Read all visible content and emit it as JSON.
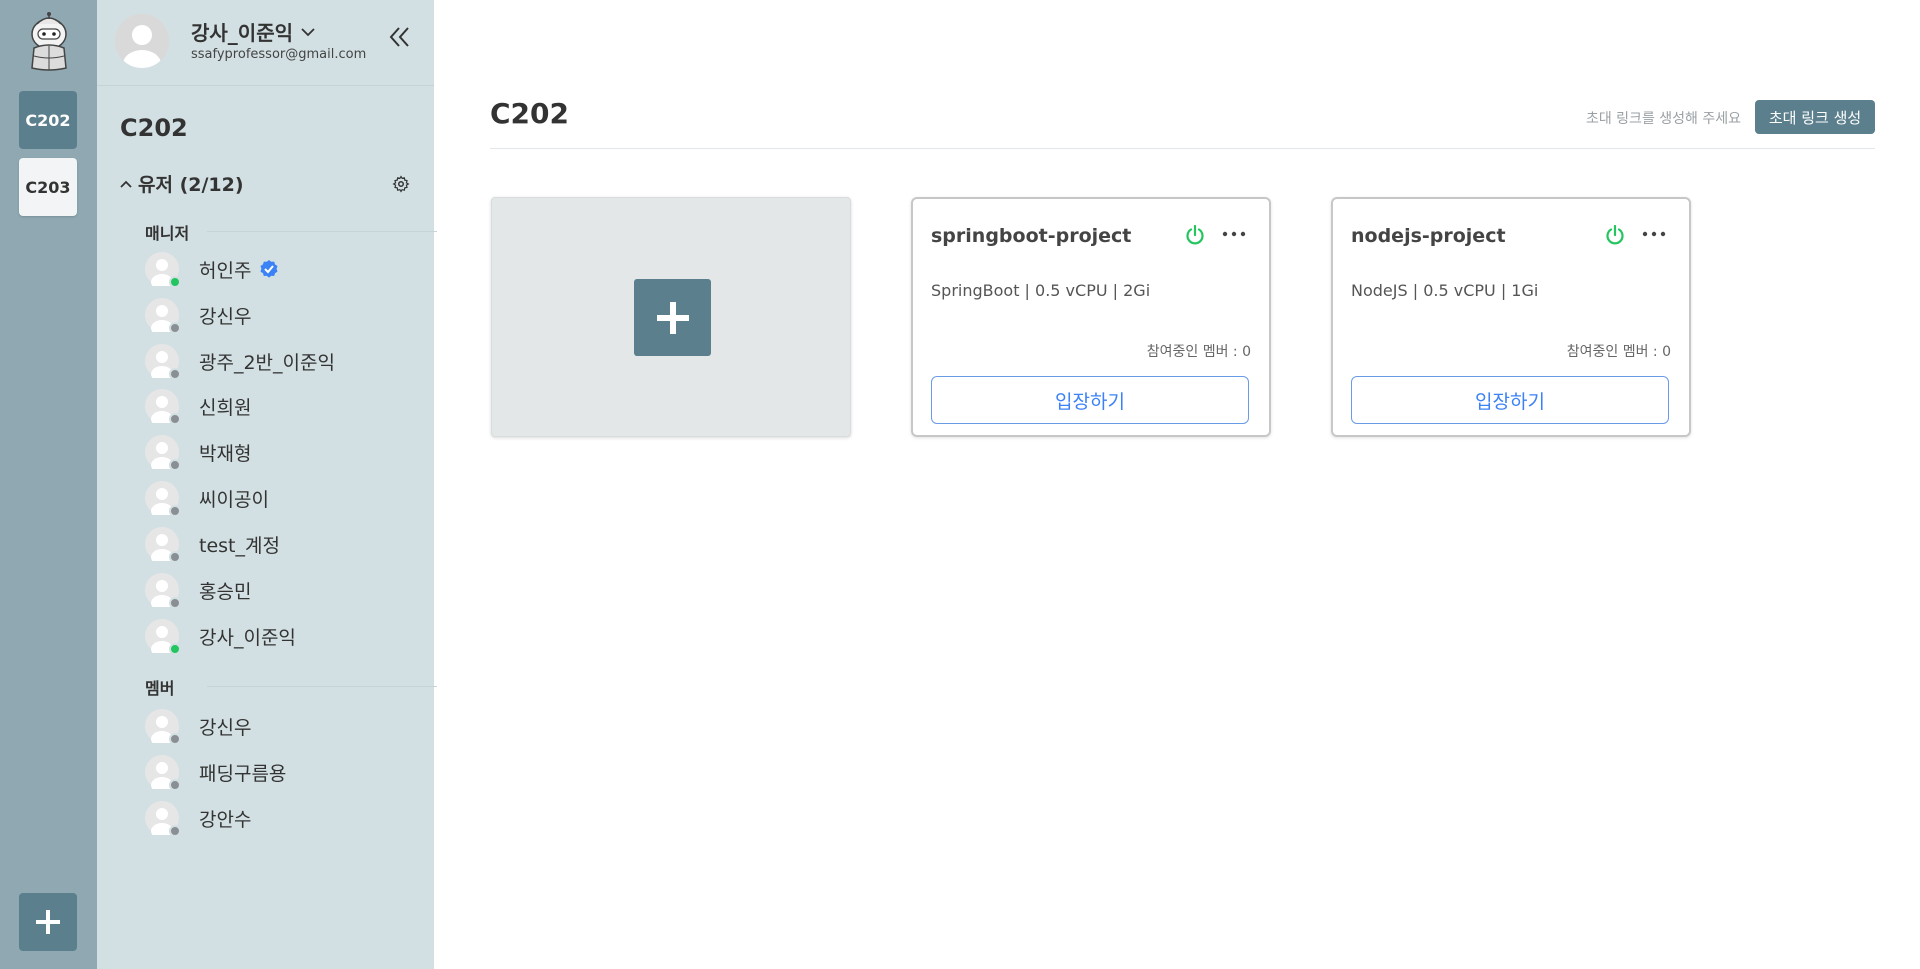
{
  "rail": {
    "workspaces": [
      "C202",
      "C203"
    ],
    "active": "C202"
  },
  "profile": {
    "name": "강사_이준익",
    "email": "ssafyprofessor@gmail.com"
  },
  "sidebar": {
    "team_title": "C202",
    "users_label": "유저 (2/12)",
    "managers_label": "매니저",
    "members_label": "멤버",
    "managers": [
      {
        "name": "허인주",
        "status": "online",
        "verified": true
      },
      {
        "name": "강신우",
        "status": "offline"
      },
      {
        "name": "광주_2반_이준익",
        "status": "offline"
      },
      {
        "name": "신희원",
        "status": "offline"
      },
      {
        "name": "박재형",
        "status": "offline"
      },
      {
        "name": "씨이공이",
        "status": "offline"
      },
      {
        "name": "test_계정",
        "status": "offline"
      },
      {
        "name": "홍승민",
        "status": "offline"
      },
      {
        "name": "강사_이준익",
        "status": "online"
      }
    ],
    "members": [
      {
        "name": "강신우",
        "status": "offline"
      },
      {
        "name": "패딩구름용",
        "status": "offline"
      },
      {
        "name": "강안수",
        "status": "offline"
      }
    ]
  },
  "main": {
    "title": "C202",
    "invite_hint": "초대 링크를 생성해 주세요",
    "invite_button": "초대 링크 생성",
    "projects": [
      {
        "name": "springboot-project",
        "spec": "SpringBoot | 0.5 vCPU | 2Gi",
        "members": "참여중인 멤버 : 0",
        "enter": "입장하기",
        "status": "running"
      },
      {
        "name": "nodejs-project",
        "spec": "NodeJS | 0.5 vCPU | 1Gi",
        "members": "참여중인 멤버 : 0",
        "enter": "입장하기",
        "status": "running"
      }
    ]
  },
  "colors": {
    "accent": "#5b7f8c",
    "rail_bg": "#8fa8b2",
    "sidebar_bg": "#d3e0e3",
    "online": "#22c55e",
    "power_on": "#22c55e",
    "link_blue": "#3b82f6"
  }
}
